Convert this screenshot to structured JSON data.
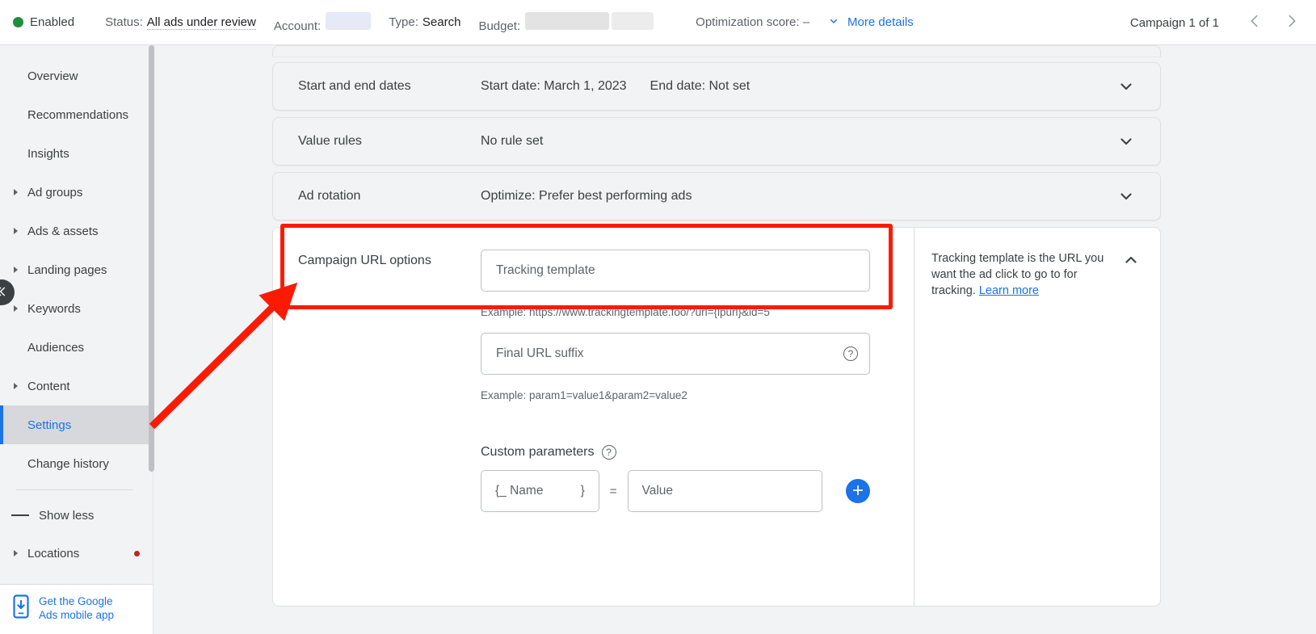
{
  "topbar": {
    "status_dot_color": "#1e8e3e",
    "enabled_label": "Enabled",
    "status_label": "Status:",
    "status_value": "All ads under review",
    "account_label": "Account:",
    "type_label": "Type:",
    "type_value": "Search",
    "budget_label": "Budget:",
    "optimization_label": "Optimization score: –",
    "more_details_label": "More details",
    "campaign_counter": "Campaign 1 of 1",
    "prev_icon": "chevron-left-icon",
    "next_icon": "chevron-right-icon",
    "more_details_icon": "chevron-down-icon"
  },
  "sidebar": {
    "items": [
      {
        "label": "Overview",
        "expandable": false,
        "selected": false,
        "dot": false
      },
      {
        "label": "Recommendations",
        "expandable": false,
        "selected": false,
        "dot": false
      },
      {
        "label": "Insights",
        "expandable": false,
        "selected": false,
        "dot": false
      },
      {
        "label": "Ad groups",
        "expandable": true,
        "selected": false,
        "dot": false
      },
      {
        "label": "Ads & assets",
        "expandable": true,
        "selected": false,
        "dot": false
      },
      {
        "label": "Landing pages",
        "expandable": true,
        "selected": false,
        "dot": false
      },
      {
        "label": "Keywords",
        "expandable": true,
        "selected": false,
        "dot": false
      },
      {
        "label": "Audiences",
        "expandable": false,
        "selected": false,
        "dot": false
      },
      {
        "label": "Content",
        "expandable": true,
        "selected": false,
        "dot": false
      },
      {
        "label": "Settings",
        "expandable": false,
        "selected": true,
        "dot": false
      },
      {
        "label": "Change history",
        "expandable": false,
        "selected": false,
        "dot": false
      }
    ],
    "show_less_label": "Show less",
    "locations": {
      "label": "Locations",
      "expandable": true,
      "dot": true
    },
    "promo": {
      "line1": "Get the Google",
      "line2": "Ads mobile app",
      "icon": "mobile-download-icon"
    },
    "collapse_icon": "chevron-double-left-icon",
    "accent_color": "#1a73e8",
    "selected_bg": "#d7d8db"
  },
  "settings_rows": [
    {
      "title": "Start and end dates",
      "values": [
        "Start date: March 1, 2023",
        "End date: Not set"
      ],
      "chevron": "chevron-down-icon"
    },
    {
      "title": "Value rules",
      "values": [
        "No rule set"
      ],
      "chevron": "chevron-down-icon"
    },
    {
      "title": "Ad rotation",
      "values": [
        "Optimize: Prefer best performing ads"
      ],
      "chevron": "chevron-down-icon"
    }
  ],
  "url_options": {
    "title": "Campaign URL options",
    "tracking_template_placeholder": "Tracking template",
    "tracking_example": "Example: https://www.trackingtemplate.foo/?url={lpurl}&id=5",
    "final_url_suffix_placeholder": "Final URL suffix",
    "final_url_help_icon": "help-circle-icon",
    "suffix_example": "Example: param1=value1&param2=value2",
    "custom_parameters_label": "Custom parameters",
    "custom_parameters_help_icon": "help-circle-icon",
    "param_name_prefix": "{_ Name",
    "param_name_suffix": "}",
    "param_equals": "=",
    "param_value_placeholder": "Value",
    "add_param_icon": "plus-circle-icon",
    "add_param_color": "#1a73e8",
    "collapse_icon": "chevron-up-icon",
    "help_panel": {
      "text": "Tracking template is the URL you want the ad click to go to for tracking.",
      "link_label": "Learn more"
    }
  },
  "annotations": {
    "highlight_color": "#fb1b04",
    "highlight_target": "Campaign URL options",
    "arrow": {
      "from": "sidebar-settings-area",
      "to": "campaign-url-options-highlight"
    }
  }
}
